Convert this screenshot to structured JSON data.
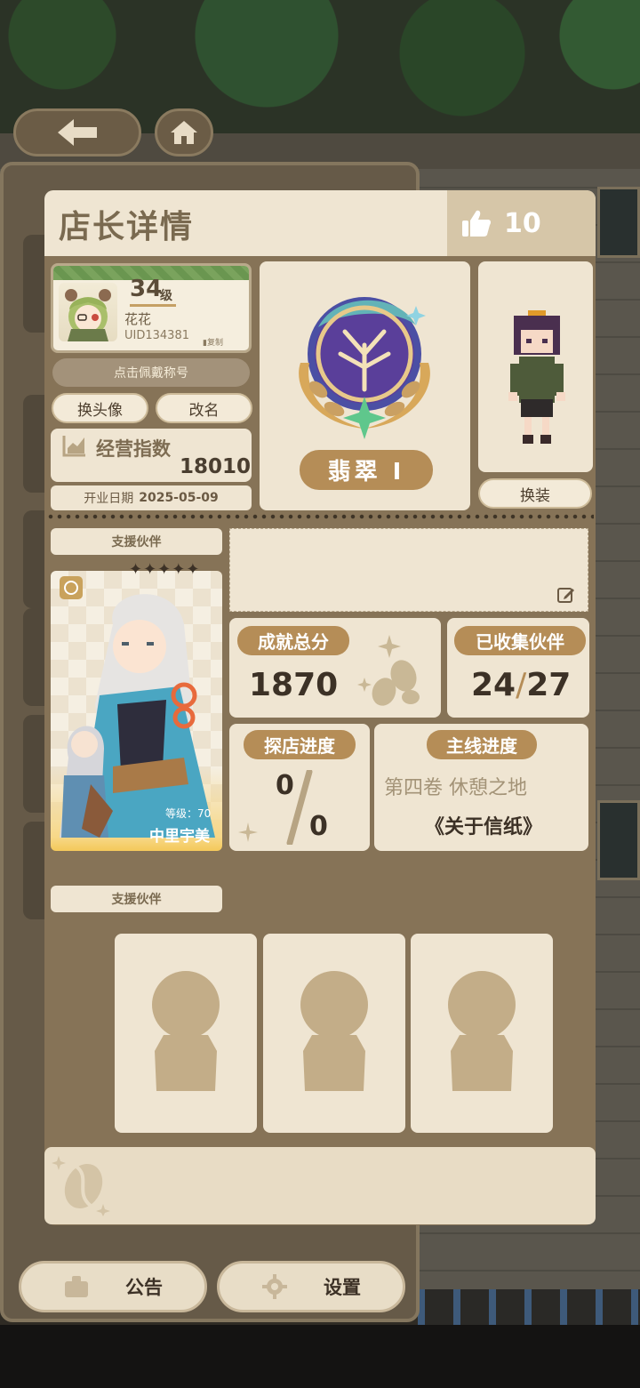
{
  "header": {
    "title": "店长详情",
    "likes": "10"
  },
  "profile": {
    "level": "34",
    "level_unit": "级",
    "username": "花花",
    "uid": "UID134381",
    "copy_label": "复制",
    "wear_title_label": "点击佩戴称号",
    "change_avatar_label": "换头像",
    "rename_label": "改名",
    "business_index_label": "经营指数",
    "business_index_value": "18010",
    "open_date_label": "开业日期",
    "open_date_value": "2025-05-09"
  },
  "rank": {
    "label": "翡翠 Ⅰ"
  },
  "character": {
    "outfit_label": "换装"
  },
  "partner": {
    "section_label": "支援伙伴",
    "stars": "✦✦✦✦✦",
    "level": "等级：70",
    "name": "中里宇美"
  },
  "stats": {
    "achievement_label": "成就总分",
    "achievement_value": "1870",
    "collected_label": "已收集伙伴",
    "collected_value": "24",
    "collected_total": "27",
    "visit_label": "探店进度",
    "visit_done": "0",
    "visit_total": "0",
    "main_label": "主线进度",
    "main_chapter": "第四卷 休憩之地",
    "main_story": "《关于信纸》"
  },
  "support": {
    "section_label": "支援伙伴"
  },
  "bottom": {
    "notice_label": "公告",
    "settings_label": "设置"
  },
  "colors": {
    "card_bg": "#867357",
    "panel_cream": "#efe5d2",
    "accent_gold": "#b58d57",
    "dark_text": "#3c3126"
  }
}
